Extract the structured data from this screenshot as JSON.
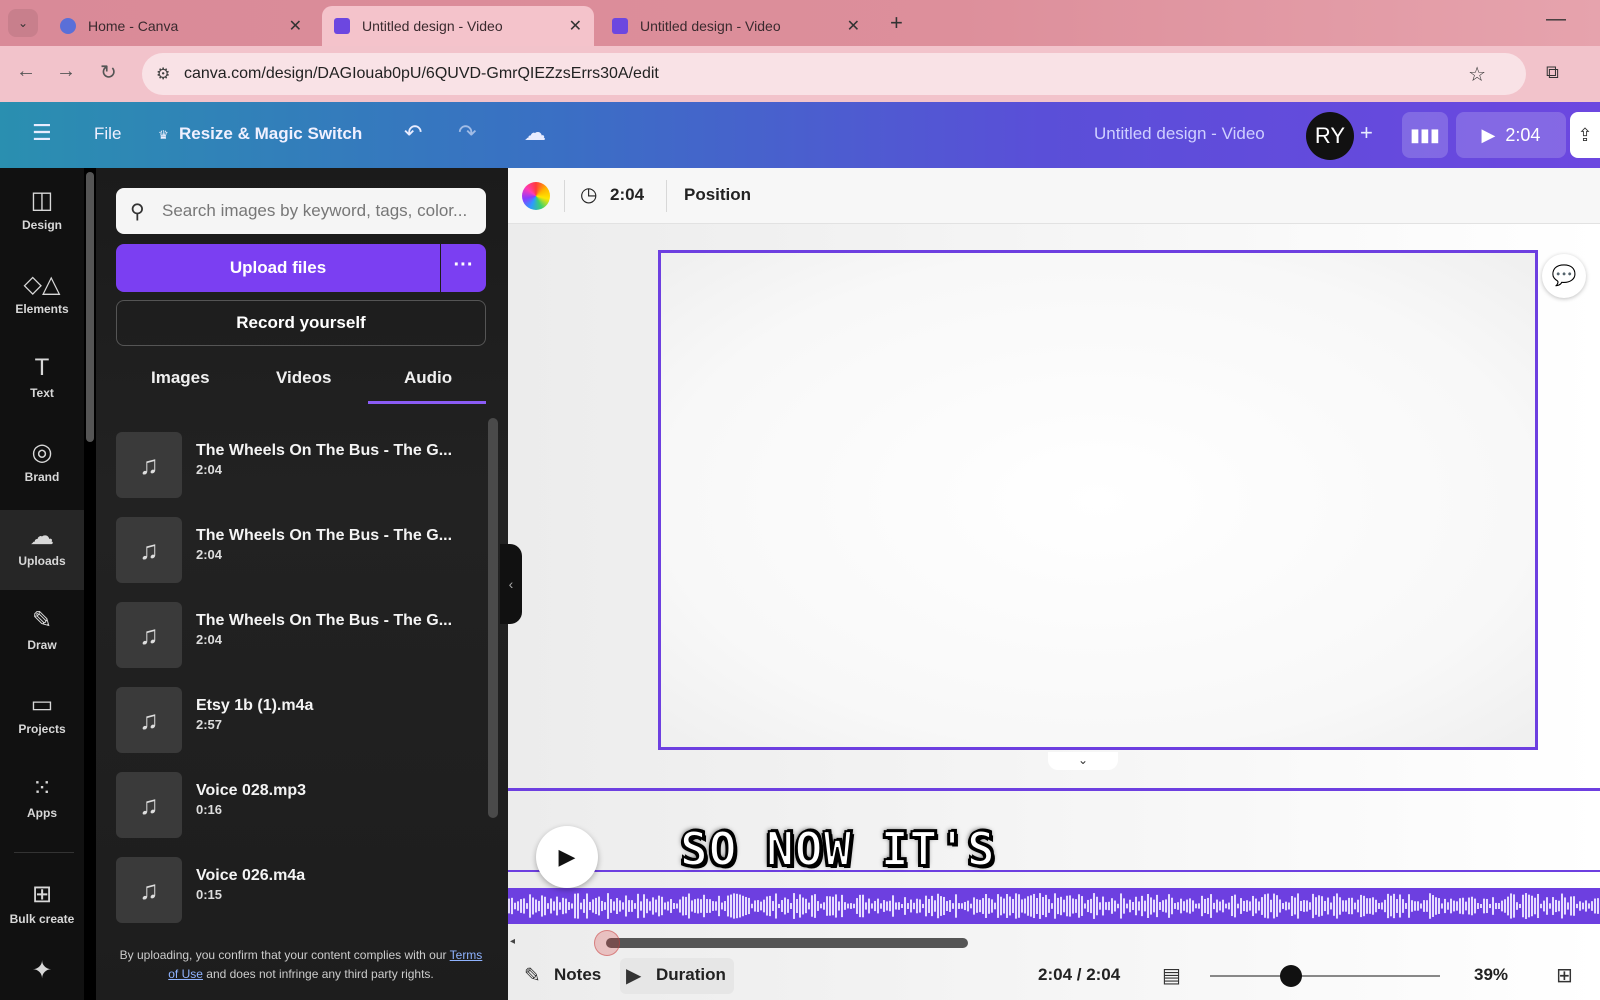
{
  "browser": {
    "tabs": [
      {
        "title": "Home - Canva",
        "active": false,
        "favicon_color": "#5a6fd8"
      },
      {
        "title": "Untitled design - Video",
        "active": true,
        "favicon_color": "#6c47e0"
      },
      {
        "title": "Untitled design - Video",
        "active": false,
        "favicon_color": "#6c47e0"
      }
    ],
    "url": "canva.com/design/DAGIouab0pU/6QUVD-GmrQIEZzsErrs30A/edit"
  },
  "header": {
    "menu_icon": "hamburger-icon",
    "file_label": "File",
    "resize_label": "Resize & Magic Switch",
    "design_title": "Untitled design - Video",
    "avatar_initials": "RY",
    "play_duration": "2:04"
  },
  "rail": {
    "items": [
      {
        "label": "Design",
        "icon": "design-icon"
      },
      {
        "label": "Elements",
        "icon": "elements-icon"
      },
      {
        "label": "Text",
        "icon": "text-icon"
      },
      {
        "label": "Brand",
        "icon": "brand-icon"
      },
      {
        "label": "Uploads",
        "icon": "uploads-icon"
      },
      {
        "label": "Draw",
        "icon": "draw-icon"
      },
      {
        "label": "Projects",
        "icon": "projects-icon"
      },
      {
        "label": "Apps",
        "icon": "apps-icon"
      },
      {
        "label": "Bulk create",
        "icon": "bulk-create-icon"
      }
    ],
    "active": "Uploads"
  },
  "panel": {
    "search_placeholder": "Search images by keyword, tags, color...",
    "upload_label": "Upload files",
    "record_label": "Record yourself",
    "tabs": [
      "Images",
      "Videos",
      "Audio"
    ],
    "active_tab": "Audio",
    "audio_items": [
      {
        "title": "The Wheels On The Bus - The G...",
        "duration": "2:04"
      },
      {
        "title": "The Wheels On The Bus - The G...",
        "duration": "2:04"
      },
      {
        "title": "The Wheels On The Bus - The G...",
        "duration": "2:04"
      },
      {
        "title": "Etsy 1b (1).m4a",
        "duration": "2:57"
      },
      {
        "title": "Voice 028.mp3",
        "duration": "0:16"
      },
      {
        "title": "Voice 026.m4a",
        "duration": "0:15"
      }
    ],
    "disclaimer_pre": "By uploading, you confirm that your content complies with our",
    "disclaimer_link": "Terms of Use",
    "disclaimer_post": "and does not infringe any third party rights."
  },
  "toolbar": {
    "duration": "2:04",
    "position_label": "Position"
  },
  "caption": "SO NOW IT'S",
  "footer": {
    "notes_label": "Notes",
    "duration_label": "Duration",
    "time": "2:04 / 2:04",
    "zoom": "39%",
    "zoom_fraction": 0.35
  },
  "colors": {
    "accent": "#7b3ff2",
    "frame": "#6d3fe0"
  }
}
